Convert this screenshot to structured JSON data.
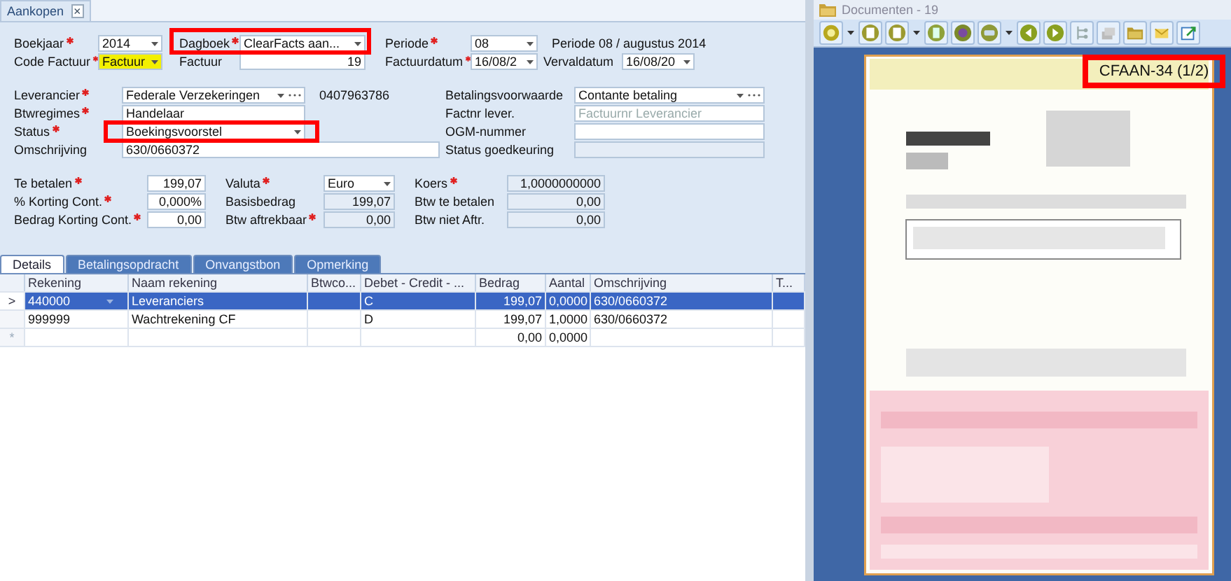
{
  "tab": {
    "label": "Aankopen",
    "close": "×"
  },
  "top_rows": [
    [
      {
        "kind": "label",
        "text": "Boekjaar",
        "required": true
      },
      {
        "kind": "combo",
        "value": "2014"
      },
      {
        "kind": "label",
        "text": "Dagboek",
        "required": true
      },
      {
        "kind": "combo",
        "value": "ClearFacts aan..."
      },
      {
        "kind": "label",
        "text": "Periode",
        "required": true
      },
      {
        "kind": "combo",
        "value": "08"
      },
      {
        "kind": "text",
        "text": "Periode 08 / augustus 2014"
      }
    ],
    [
      {
        "kind": "label",
        "text": "Code Factuur",
        "required": true
      },
      {
        "kind": "combo",
        "value": "Factuur",
        "highlighted": true
      },
      {
        "kind": "label",
        "text": "Factuur",
        "required": false
      },
      {
        "kind": "number",
        "value": "19"
      },
      {
        "kind": "label",
        "text": "Factuurdatum",
        "required": true
      },
      {
        "kind": "combo",
        "value": "16/08/2"
      },
      {
        "kind": "label",
        "text": "Vervaldatum",
        "required": false
      },
      {
        "kind": "combo",
        "value": "16/08/20"
      }
    ]
  ],
  "mid_rows": [
    [
      {
        "kind": "label",
        "text": "Leverancier",
        "required": true
      },
      {
        "kind": "lookup",
        "value": "Federale Verzekeringen"
      },
      {
        "kind": "text",
        "text": "0407963786"
      },
      {
        "kind": "label",
        "text": "Betalingsvoorwaarde",
        "required": false
      },
      {
        "kind": "lookup",
        "value": "Contante betaling"
      }
    ],
    [
      {
        "kind": "label",
        "text": "Btwregimes",
        "required": true
      },
      {
        "kind": "input",
        "value": "Handelaar"
      },
      {
        "kind": "label",
        "text": "Factnr lever.",
        "required": false
      },
      {
        "kind": "input",
        "placeholder": "Factuurnr Leverancier"
      }
    ],
    [
      {
        "kind": "label",
        "text": "Status",
        "required": true
      },
      {
        "kind": "combo",
        "value": "Boekingsvoorstel"
      },
      {
        "kind": "label",
        "text": "OGM-nummer",
        "required": false
      },
      {
        "kind": "input"
      }
    ],
    [
      {
        "kind": "label",
        "text": "Omschrijving",
        "required": false
      },
      {
        "kind": "input",
        "value": "630/0660372"
      },
      {
        "kind": "label",
        "text": "Status goedkeuring",
        "required": false
      },
      {
        "kind": "readonly"
      }
    ]
  ],
  "amount_rows": [
    [
      {
        "kind": "label",
        "text": "Te betalen",
        "required": true
      },
      {
        "kind": "number",
        "value": "199,07"
      },
      {
        "kind": "label",
        "text": "Valuta",
        "required": true
      },
      {
        "kind": "combo",
        "value": "Euro"
      },
      {
        "kind": "label",
        "text": "Koers",
        "required": true
      },
      {
        "kind": "readonly",
        "value": "1,0000000000"
      }
    ],
    [
      {
        "kind": "label",
        "text": "% Korting Cont.",
        "required": true
      },
      {
        "kind": "number",
        "value": "0,000%"
      },
      {
        "kind": "label",
        "text": "Basisbedrag",
        "required": false
      },
      {
        "kind": "readonly",
        "value": "199,07"
      },
      {
        "kind": "label",
        "text": "Btw te betalen",
        "required": false
      },
      {
        "kind": "readonly",
        "value": "0,00"
      }
    ],
    [
      {
        "kind": "label",
        "text": "Bedrag Korting Cont.",
        "required": true
      },
      {
        "kind": "number",
        "value": "0,00"
      },
      {
        "kind": "label",
        "text": "Btw aftrekbaar",
        "required": true
      },
      {
        "kind": "readonly",
        "value": "0,00"
      },
      {
        "kind": "label",
        "text": "Btw niet Aftr.",
        "required": false
      },
      {
        "kind": "readonly",
        "value": "0,00"
      }
    ]
  ],
  "detail_tabs": [
    {
      "label": "Details",
      "selected": true
    },
    {
      "label": "Betalingsopdracht",
      "selected": false
    },
    {
      "label": "Onvangstbon",
      "selected": false
    },
    {
      "label": "Opmerking",
      "selected": false
    }
  ],
  "table": {
    "columns": [
      "Rekening",
      "Naam rekening",
      "Btwco...",
      "Debet - Credit - ...",
      "Bedrag",
      "Aantal",
      "Omschrijving",
      "T..."
    ],
    "rows": [
      {
        "marker": ">",
        "selected": true,
        "cells": [
          "440000",
          "Leveranciers",
          "",
          "C",
          "199,07",
          "0,0000",
          "630/0660372",
          ""
        ]
      },
      {
        "marker": "",
        "selected": false,
        "cells": [
          "999999",
          "Wachtrekening CF",
          "",
          "D",
          "199,07",
          "1,0000",
          "630/0660372",
          ""
        ]
      },
      {
        "marker": "*",
        "selected": false,
        "new_row": true,
        "cells": [
          "",
          "",
          "",
          "",
          "0,00",
          "0,0000",
          "",
          ""
        ]
      }
    ]
  },
  "viewer": {
    "title": "Documenten - 19",
    "stamp": "CFAAN-34 (1/2)"
  }
}
